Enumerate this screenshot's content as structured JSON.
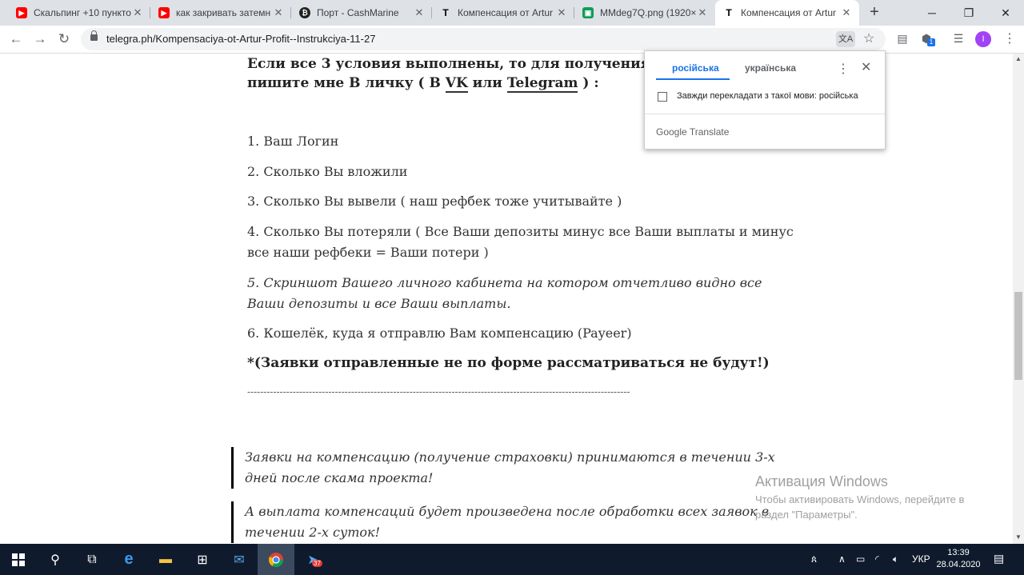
{
  "tabs": [
    {
      "title": "Скальпинг +10 пункто",
      "favicon": "youtube-icon",
      "color": "#ff0000"
    },
    {
      "title": "как закривать затемн",
      "favicon": "youtube-icon",
      "color": "#ff0000"
    },
    {
      "title": "Порт - CashMarine",
      "favicon": "cashmarine-icon",
      "color": "#222222"
    },
    {
      "title": "Компенсация от Artur",
      "favicon": "telegraph-icon",
      "color": "#000000"
    },
    {
      "title": "MMdeg7Q.png (1920×",
      "favicon": "image-icon",
      "color": "#0f9d58"
    },
    {
      "title": "Компенсация от Artur",
      "favicon": "telegraph-icon",
      "color": "#000000",
      "active": true
    }
  ],
  "toolbar": {
    "url": "telegra.ph/Kompensaciya-ot-Artur-Profit--Instrukciya-11-27",
    "extension_badge": "1",
    "avatar_letter": "I"
  },
  "article": {
    "intro_line1": "Если все 3 условия выполнены, то для получения стра",
    "intro_line2_pre": "пишите мне В личку  ( В ",
    "link_vk": "VK",
    "intro_line2_mid": " или ",
    "link_telegram": "Telegram",
    "intro_line2_post": " ) :",
    "items": [
      "1. Ваш Логин",
      "2. Сколько Вы вложили",
      "3. Сколько Вы вывели ( наш рефбек тоже учитывайте )",
      "4. Сколько Вы потеряли ( Все Ваши депозиты минус все Ваши выплаты и минус",
      "все наши рефбеки = Ваши потери )",
      "5. Скриншот Вашего личного кабинета на котором отчетливо видно все",
      "Ваши депозиты и все Ваши выплаты.",
      "6. Кошелёк, куда я отправлю Вам компенсацию (Payeer)"
    ],
    "note": "*(Заявки отправленные не по форме рассматриваться не будут!)",
    "divider": "----------------------------------------------------------------------------------------------------------------------",
    "quote1_line1": "Заявки на компенсацию (получение страховки) принимаются в течении 3-х",
    "quote1_line2": "дней после скама проекта!",
    "quote2_line1": "А выплата компенсаций будет произведена после обработки всех заявок в",
    "quote2_line2": "течении 2-х суток!"
  },
  "translate_popup": {
    "tab_source": "російська",
    "tab_target": "українська",
    "checkbox_label": "Завжди перекладати з такої мови: російська",
    "footer": "Google Translate"
  },
  "watermark": {
    "title": "Активация Windows",
    "line1": "Чтобы активировать Windows, перейдите в",
    "line2": "раздел \"Параметры\"."
  },
  "taskbar": {
    "chrome_badge": "37",
    "lang": "УКР",
    "time": "13:39",
    "date": "28.04.2020"
  }
}
